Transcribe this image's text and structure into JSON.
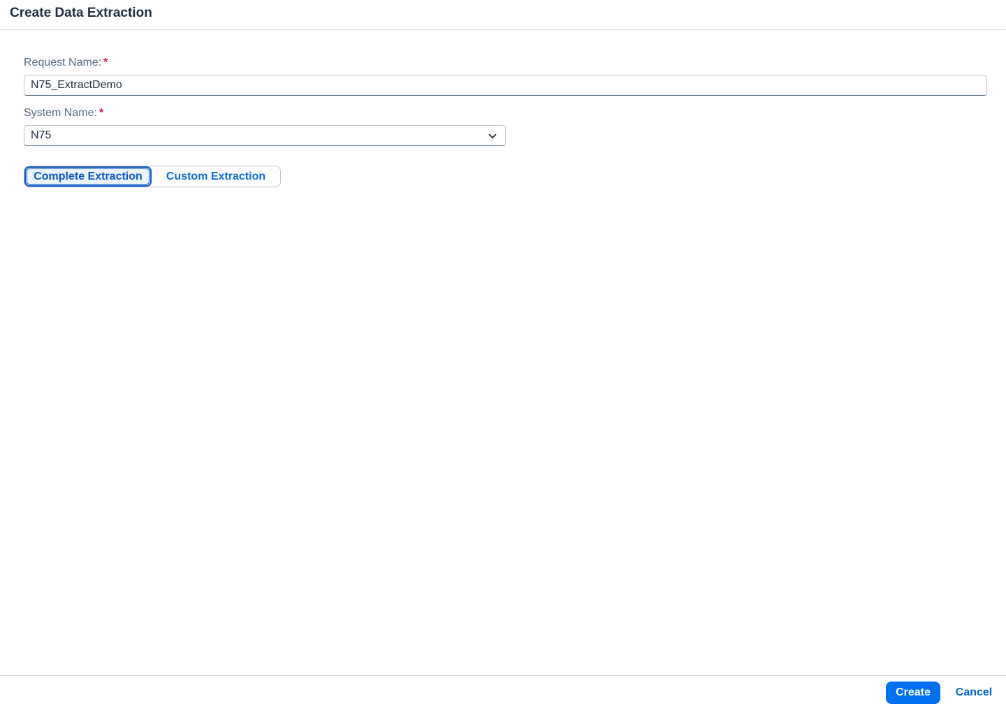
{
  "dialog": {
    "title": "Create Data Extraction"
  },
  "form": {
    "request_name": {
      "label": "Request Name:",
      "required_marker": "*",
      "value": "N75_ExtractDemo"
    },
    "system_name": {
      "label": "System Name:",
      "required_marker": "*",
      "selected_value": "N75",
      "icon": "chevron-down-icon"
    },
    "extraction_mode": {
      "options": [
        "Complete Extraction",
        "Custom Extraction"
      ],
      "selected": "Complete Extraction"
    }
  },
  "footer": {
    "create_label": "Create",
    "cancel_label": "Cancel"
  },
  "colors": {
    "accent": "#0070f2",
    "link": "#0064d9",
    "required": "#c0155a",
    "title": "#1d2d3e",
    "label": "#556b82"
  }
}
